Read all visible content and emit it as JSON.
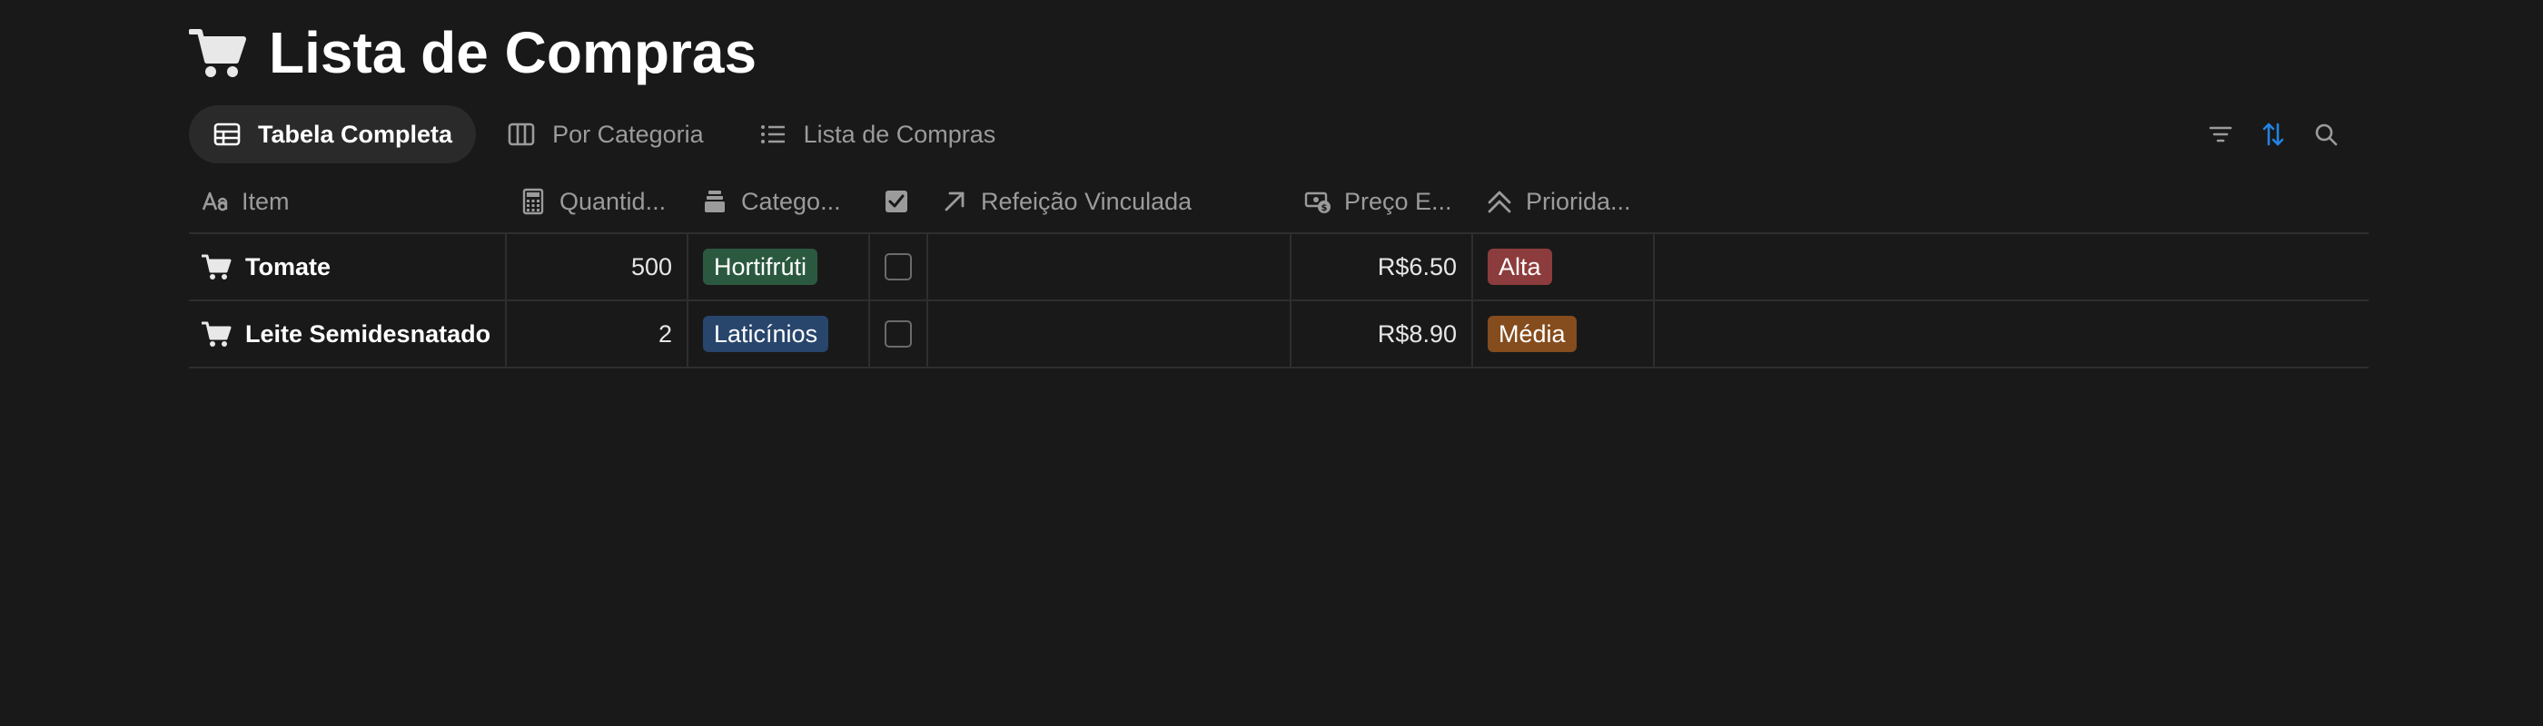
{
  "page": {
    "title": "Lista de Compras",
    "title_icon": "shopping-cart-icon"
  },
  "views": [
    {
      "label": "Tabela Completa",
      "icon": "table-icon",
      "active": true
    },
    {
      "label": "Por Categoria",
      "icon": "board-columns-icon",
      "active": false
    },
    {
      "label": "Lista de Compras",
      "icon": "list-icon",
      "active": false
    }
  ],
  "toolbar": {
    "filter_icon": "filter-icon",
    "sort_icon": "sort-icon",
    "search_icon": "search-icon",
    "sort_color": "#2383e2"
  },
  "table": {
    "columns": [
      {
        "label": "Item",
        "icon": "text-aa-icon"
      },
      {
        "label": "Quantid...",
        "icon": "calculator-icon"
      },
      {
        "label": "Catego...",
        "icon": "stack-icon"
      },
      {
        "label": "",
        "icon": "checkbox-checked-icon"
      },
      {
        "label": "Refeição Vinculada",
        "icon": "relation-arrow-icon"
      },
      {
        "label": "Preço E...",
        "icon": "money-icon"
      },
      {
        "label": "Priorida...",
        "icon": "chevrons-up-icon"
      }
    ],
    "rows": [
      {
        "item": "Tomate",
        "quantity": "500",
        "category": {
          "label": "Hortifrúti",
          "color": "#2b593f"
        },
        "checked": false,
        "meal": "",
        "price": "R$6.50",
        "priority": {
          "label": "Alta",
          "color": "#8c3c3c"
        }
      },
      {
        "item": "Leite Semidesnatado",
        "quantity": "2",
        "category": {
          "label": "Laticínios",
          "color": "#28456c"
        },
        "checked": false,
        "meal": "",
        "price": "R$8.90",
        "priority": {
          "label": "Média",
          "color": "#854c1d"
        }
      }
    ]
  },
  "colors": {
    "background": "#191919",
    "border": "#2e2e2e",
    "muted_text": "#9b9b9b"
  }
}
